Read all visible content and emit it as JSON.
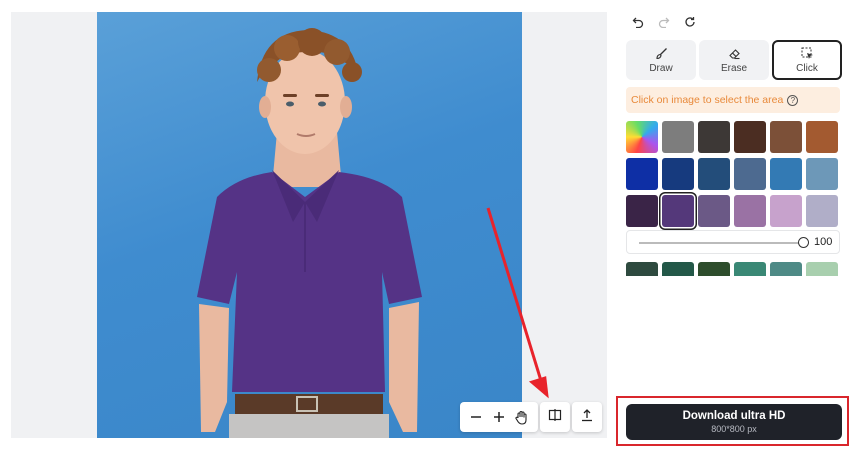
{
  "toolbar": {
    "zoom_out_icon": "minus-icon",
    "zoom_in_icon": "plus-icon",
    "pan_icon": "hand-icon",
    "compare_icon": "split-view-icon",
    "export_icon": "upload-icon"
  },
  "history": {
    "undo_icon": "undo-icon",
    "redo_icon": "redo-icon",
    "reset_icon": "refresh-icon"
  },
  "modes": [
    {
      "label": "Draw",
      "icon": "brush-icon",
      "active": false
    },
    {
      "label": "Erase",
      "icon": "eraser-icon",
      "active": false
    },
    {
      "label": "Click",
      "icon": "select-cursor-icon",
      "active": true
    }
  ],
  "hint": {
    "text": "Click on image to select the area"
  },
  "colors": {
    "swatches": [
      "rainbow",
      "#7d7d7d",
      "#3d3836",
      "#4b2d22",
      "#7c5038",
      "#a35a30",
      "#0e2fa5",
      "#163a7e",
      "#234d7a",
      "#4d6a90",
      "#337ab4",
      "#6d98b8",
      "#3a2447",
      "#54387a",
      "#6b5986",
      "#9a72a4",
      "#c7a2cc",
      "#b0aec8"
    ],
    "selected_index": 13,
    "second_row": [
      "#2e4a3f",
      "#235848",
      "#2e4d2c",
      "#3a8875",
      "#4e8a86",
      "#a8cfae"
    ]
  },
  "slider": {
    "value": "100",
    "fraction": 1.0
  },
  "download": {
    "label": "Download ultra HD",
    "size": "800*800 px"
  },
  "accent": {
    "annotation_red": "#d9262c",
    "hint_orange": "#e8893a"
  }
}
